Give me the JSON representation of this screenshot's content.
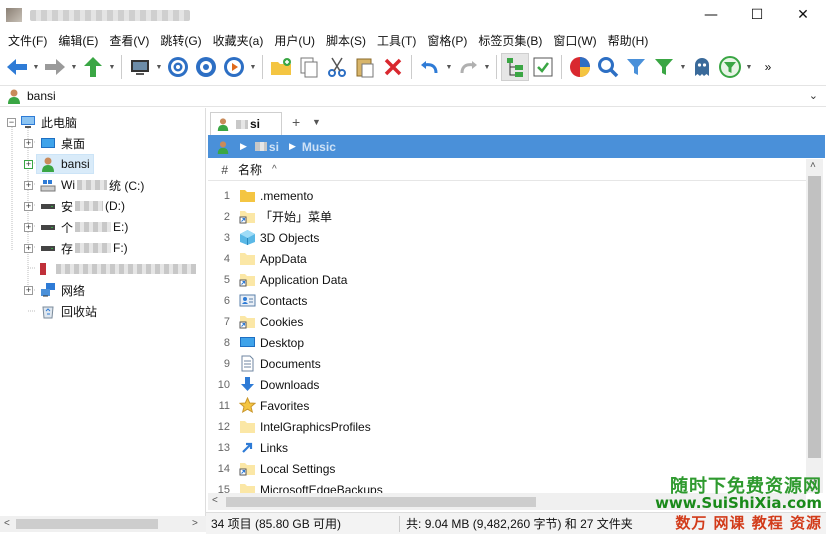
{
  "window": {
    "minimize_glyph": "—",
    "maximize_glyph": "☐",
    "close_glyph": "✕"
  },
  "menu": [
    "文件(F)",
    "编辑(E)",
    "查看(V)",
    "跳转(G)",
    "收藏夹(a)",
    "用户(U)",
    "脚本(S)",
    "工具(T)",
    "窗格(P)",
    "标签页集(B)",
    "窗口(W)",
    "帮助(H)"
  ],
  "toolbar": {
    "icons": [
      "back-arrow-icon",
      "forward-arrow-icon",
      "up-arrow-icon",
      "computer-icon",
      "target-icon",
      "blue-circle-icon",
      "orange-circle-icon",
      "new-folder-icon",
      "copy-icon",
      "cut-icon",
      "paste-icon",
      "delete-icon",
      "undo-icon",
      "redo-icon",
      "tree-view-icon",
      "checkbox-icon",
      "pie-chart-icon",
      "search-icon",
      "filter-icon",
      "green-filter-icon",
      "ghost-icon",
      "filter-circle-icon"
    ],
    "more_glyph": "»"
  },
  "address": {
    "path": "bansi"
  },
  "tree": {
    "items": [
      {
        "label": "此电脑",
        "icon": "computer-icon"
      },
      {
        "label": "桌面",
        "icon": "desktop-icon"
      },
      {
        "label": "bansi",
        "icon": "user-icon"
      },
      {
        "label_prefix": "Wi",
        "label_suffix": "统 (C:)",
        "icon": "drive-icon"
      },
      {
        "label_prefix": "安",
        "label_suffix": "(D:)",
        "icon": "drive-icon"
      },
      {
        "label_prefix": "个",
        "label_suffix": "E:)",
        "icon": "drive-icon"
      },
      {
        "label_prefix": "存",
        "label_suffix": "F:)",
        "icon": "drive-icon"
      },
      {
        "label": "网络",
        "icon": "network-icon"
      },
      {
        "label": "回收站",
        "icon": "recycle-bin-icon"
      }
    ]
  },
  "tab": {
    "label": "si",
    "plus": "+",
    "dropdown": "▼"
  },
  "breadcrumb": {
    "user": "si",
    "folder": "Music"
  },
  "columns": {
    "number": "#",
    "name": "名称",
    "sort": "^"
  },
  "files": [
    {
      "n": "1",
      "name": ".memento",
      "icon": "folder"
    },
    {
      "n": "2",
      "name": "「开始」菜单",
      "icon": "shortcut"
    },
    {
      "n": "3",
      "name": "3D Objects",
      "icon": "objects3d"
    },
    {
      "n": "4",
      "name": "AppData",
      "icon": "folder-light"
    },
    {
      "n": "5",
      "name": "Application Data",
      "icon": "shortcut"
    },
    {
      "n": "6",
      "name": "Contacts",
      "icon": "contacts"
    },
    {
      "n": "7",
      "name": "Cookies",
      "icon": "shortcut"
    },
    {
      "n": "8",
      "name": "Desktop",
      "icon": "desktop"
    },
    {
      "n": "9",
      "name": "Documents",
      "icon": "documents"
    },
    {
      "n": "10",
      "name": "Downloads",
      "icon": "downloads"
    },
    {
      "n": "11",
      "name": "Favorites",
      "icon": "star"
    },
    {
      "n": "12",
      "name": "IntelGraphicsProfiles",
      "icon": "folder-light"
    },
    {
      "n": "13",
      "name": "Links",
      "icon": "links"
    },
    {
      "n": "14",
      "name": "Local Settings",
      "icon": "shortcut"
    },
    {
      "n": "15",
      "name": "MicrosoftEdgeBackups",
      "icon": "folder-light"
    }
  ],
  "status": {
    "left": "34 项目 (85.80 GB 可用)",
    "right": "共: 9.04 MB (9,482,260 字节) 和 27 文件夹"
  },
  "watermark": {
    "line1": "随时下免费资源网",
    "line2": "www.SuiShiXia.com",
    "line3": "数万 网课 教程 资源"
  },
  "colors": {
    "breadcrumb_bg": "#4a90d9",
    "selection_bg": "#d9ebf9",
    "folder_yellow": "#f7d774"
  }
}
